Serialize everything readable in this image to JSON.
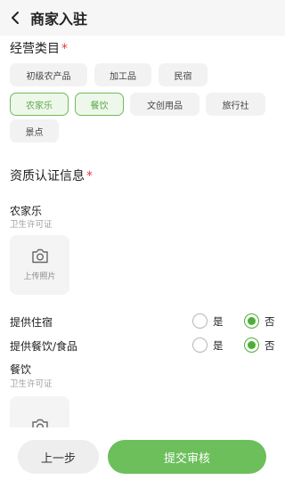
{
  "header": {
    "title": "商家入驻",
    "back_icon": "chevron-left-icon"
  },
  "category": {
    "title": "经营类目",
    "required_mark": "*",
    "tags": [
      {
        "label": "初级农产品",
        "selected": false
      },
      {
        "label": "加工品",
        "selected": false
      },
      {
        "label": "民宿",
        "selected": false
      },
      {
        "label": "农家乐",
        "selected": true
      },
      {
        "label": "餐饮",
        "selected": true
      },
      {
        "label": "文创用品",
        "selected": false
      },
      {
        "label": "旅行社",
        "selected": false
      },
      {
        "label": "景点",
        "selected": false
      }
    ]
  },
  "qualification": {
    "title": "资质认证信息",
    "required_mark": "*",
    "farm": {
      "title": "农家乐",
      "hint": "卫生许可证",
      "upload_label": "上传照片"
    },
    "questions": [
      {
        "label": "提供住宿",
        "yes": "是",
        "no": "否",
        "value": "否"
      },
      {
        "label": "提供餐饮/食品",
        "yes": "是",
        "no": "否",
        "value": "否"
      }
    ],
    "catering": {
      "title": "餐饮",
      "hint": "卫生许可证"
    }
  },
  "footer": {
    "prev_label": "上一步",
    "submit_label": "提交审核"
  },
  "colors": {
    "accent": "#6cbf5b",
    "radio_on": "#4caf35",
    "required": "#e23b3b"
  }
}
